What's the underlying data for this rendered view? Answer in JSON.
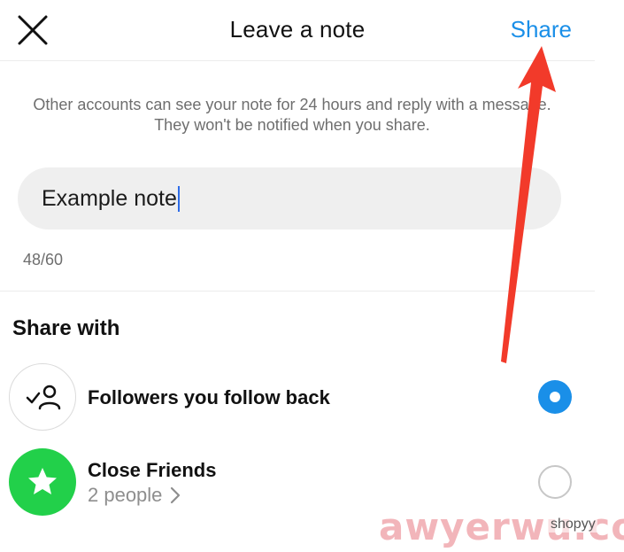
{
  "header": {
    "title": "Leave a note",
    "share_label": "Share"
  },
  "info_text": "Other accounts can see your note for 24 hours and reply with a message. They won't be notified when you share.",
  "note": {
    "value": "Example note",
    "counter": "48/60"
  },
  "share_with": {
    "title": "Share with",
    "options": [
      {
        "label": "Followers you follow back",
        "icon": "mutual-followers-icon",
        "selected": true
      },
      {
        "label": "Close Friends",
        "subtitle": "2 people",
        "icon": "star-icon",
        "selected": false
      }
    ]
  },
  "watermark": {
    "text": "awyerwu.com",
    "small_text": "shopyy"
  },
  "colors": {
    "accent": "#1a8fe8",
    "close_friends_green": "#22d04a",
    "annotation_arrow": "#f23a2a"
  }
}
